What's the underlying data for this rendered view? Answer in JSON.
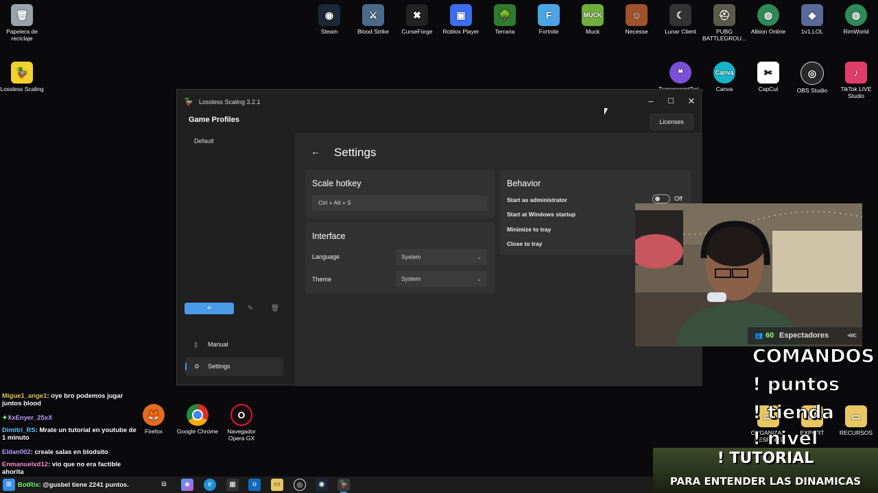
{
  "desktop_icons": [
    {
      "label": "Papelera de reciclaje",
      "icon": "recycle-bin-icon"
    },
    {
      "label": "Lossless Scaling",
      "icon": "duck-icon"
    },
    {
      "label": "Steam",
      "icon": "steam-icon"
    },
    {
      "label": "Blood Strike",
      "icon": "blood-strike-icon"
    },
    {
      "label": "CurseForge",
      "icon": "curseforge-icon"
    },
    {
      "label": "Roblox Player",
      "icon": "roblox-icon"
    },
    {
      "label": "Terraria",
      "icon": "terraria-icon"
    },
    {
      "label": "Fortnite",
      "icon": "fortnite-icon"
    },
    {
      "label": "Muck",
      "icon": "muck-icon"
    },
    {
      "label": "Necesse",
      "icon": "necesse-icon"
    },
    {
      "label": "Lunar Client",
      "icon": "lunar-client-icon"
    },
    {
      "label": "PUBG BATTLEGROU...",
      "icon": "pubg-icon"
    },
    {
      "label": "Albion Online",
      "icon": "albion-icon"
    },
    {
      "label": "1v1.LOL",
      "icon": "1v1lol-icon"
    },
    {
      "label": "RimWorld",
      "icon": "rimworld-icon"
    },
    {
      "label": "TransparentTwi...",
      "icon": "transparent-twitch-icon"
    },
    {
      "label": "Canva",
      "icon": "canva-icon"
    },
    {
      "label": "CapCut",
      "icon": "capcut-icon"
    },
    {
      "label": "OBS Studio",
      "icon": "obs-icon"
    },
    {
      "label": "TikTok LIVE Studio",
      "icon": "tiktok-icon"
    },
    {
      "label": "Firefox",
      "icon": "firefox-icon"
    },
    {
      "label": "Google Chrome",
      "icon": "chrome-icon"
    },
    {
      "label": "Navegador Opera GX",
      "icon": "opera-gx-icon"
    },
    {
      "label": "ORGANIZAR DESPUES",
      "icon": "folder-icon"
    },
    {
      "label": "EXPORT",
      "icon": "folder-icon"
    },
    {
      "label": "RECURSOS",
      "icon": "folder-icon"
    }
  ],
  "window": {
    "title": "Lossless Scaling 3.2.1",
    "sidebar_title": "Game Profiles",
    "profiles": [
      "Default"
    ],
    "add_label": "+",
    "nav": [
      {
        "label": "Manual",
        "icon": "book-icon"
      },
      {
        "label": "Settings",
        "icon": "gear-icon"
      }
    ],
    "licenses_label": "Licenses",
    "page_title": "Settings",
    "scale_hotkey": {
      "title": "Scale hotkey",
      "value": "Ctrl + Alt + S"
    },
    "interface": {
      "title": "Interface",
      "language_label": "Language",
      "language_value": "System",
      "theme_label": "Theme",
      "theme_value": "System"
    },
    "behavior": {
      "title": "Behavior",
      "items": [
        "Start as administrator",
        "Start at Windows startup",
        "Minimize to tray",
        "Close to tray"
      ],
      "toggle_state": "Off"
    }
  },
  "stream": {
    "viewers_count": "60",
    "viewers_label": "Espectadores",
    "commands": [
      "COMANDOS",
      "! puntos",
      "! tienda",
      "! nivel"
    ],
    "banner_title": "! TUTORIAL",
    "banner_sub": "PARA ENTENDER LAS DINAMICAS"
  },
  "chat": [
    {
      "user": "Migue1_ange1",
      "text": ": oye bro podemos jugar juntos blood"
    },
    {
      "user": "XxEnyer_25xX",
      "text": ""
    },
    {
      "user": "Dimitri_RS",
      "text": ": Mrate un tutorial en youtube de 1 minuto"
    },
    {
      "user": "Eldan002",
      "text": ": creale salas en blodsito"
    },
    {
      "user": "Enmanuelxd12",
      "text": ": vio que no era factible ahorita"
    },
    {
      "user": "BotRix",
      "text": ": @gusbel tiene 2241 puntos."
    }
  ]
}
